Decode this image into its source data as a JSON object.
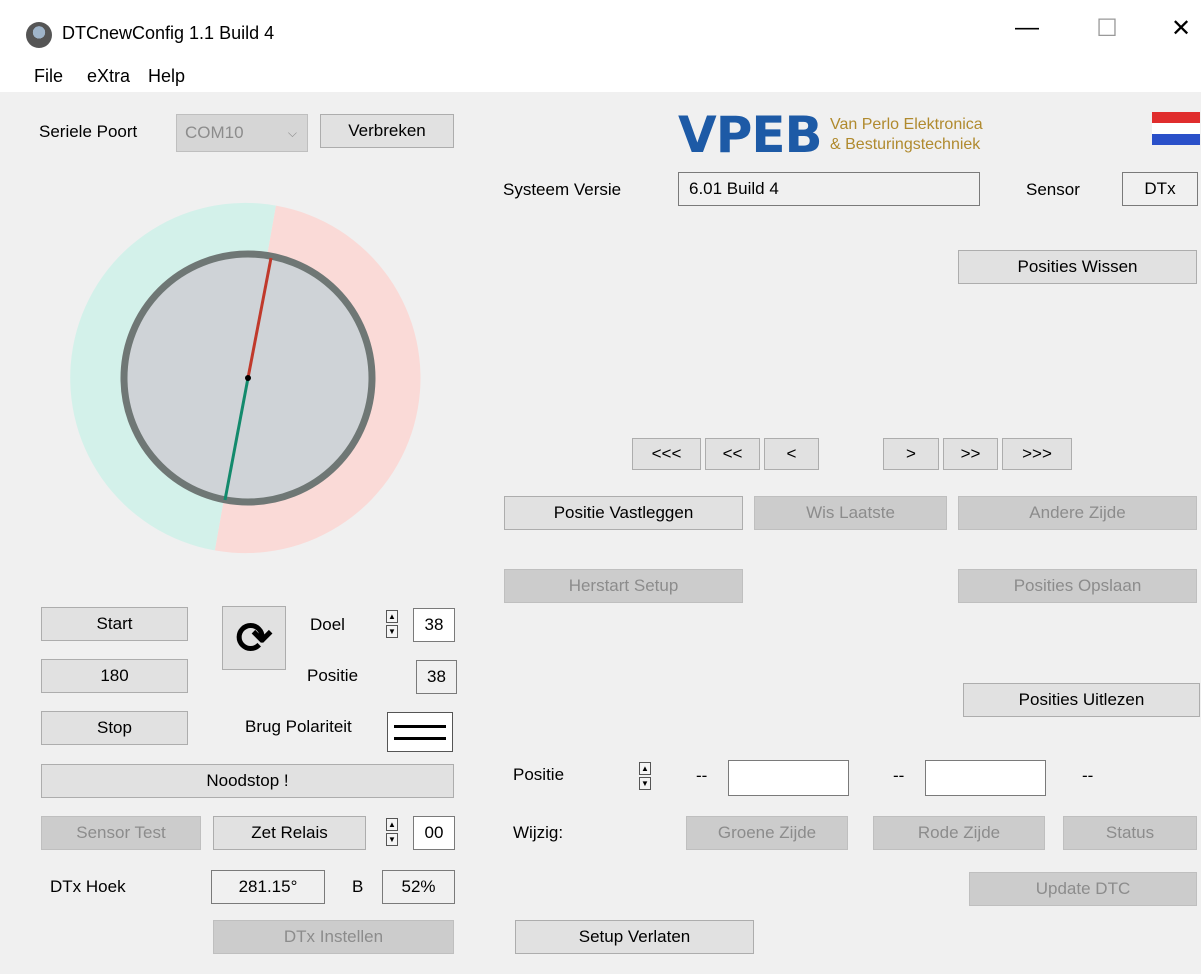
{
  "window": {
    "title": "DTCnewConfig 1.1 Build 4",
    "minimize": "—",
    "maximize": "☐",
    "close": "✕"
  },
  "menu": {
    "file": "File",
    "extra": "eXtra",
    "help": "Help"
  },
  "serial": {
    "label": "Seriele Poort",
    "port": "COM10",
    "disconnect": "Verbreken"
  },
  "logo": {
    "brand": "VPEB",
    "line1": "Van Perlo Elektronica",
    "line2": "& Besturingstechniek"
  },
  "system": {
    "version_label": "Systeem Versie",
    "version": "6.01 Build 4",
    "sensor_label": "Sensor",
    "sensor": "DTx"
  },
  "buttons": {
    "clear_positions": "Posities Wissen",
    "nav": [
      "<<<",
      "<<",
      "<",
      ">",
      ">>",
      ">>>"
    ],
    "record_position": "Positie Vastleggen",
    "erase_last": "Wis Laatste",
    "other_side": "Andere Zijde",
    "restart_setup": "Herstart Setup",
    "save_positions": "Posities Opslaan",
    "read_positions": "Posities Uitlezen",
    "green_side": "Groene Zijde",
    "red_side": "Rode Zijde",
    "status": "Status",
    "update_dtc": "Update DTC",
    "leave_setup": "Setup Verlaten",
    "start": "Start",
    "value_180": "180",
    "stop": "Stop",
    "emergency_stop": "Noodstop !",
    "sensor_test": "Sensor Test",
    "set_relay": "Zet Relais",
    "dtx_configure": "DTx Instellen"
  },
  "controls": {
    "target_label": "Doel",
    "target": "38",
    "position_label": "Positie",
    "position": "38",
    "bridge_label": "Brug Polariteit",
    "relay": "00",
    "dtx_angle_label": "DTx Hoek",
    "dtx_angle": "281.15°",
    "b_label": "B",
    "b_value": "52%"
  },
  "lower": {
    "position_label": "Positie",
    "dash1": "--",
    "dash2": "--",
    "dash3": "--",
    "change_label": "Wijzig:"
  },
  "colors": {
    "green_zone": "#d3f1ea",
    "red_zone": "#fadad7",
    "dial": "#cfd3d7",
    "ring": "#6f7775",
    "needle_red": "#c0392b",
    "needle_green": "#138a6c",
    "logo_blue": "#1d5aa6"
  }
}
